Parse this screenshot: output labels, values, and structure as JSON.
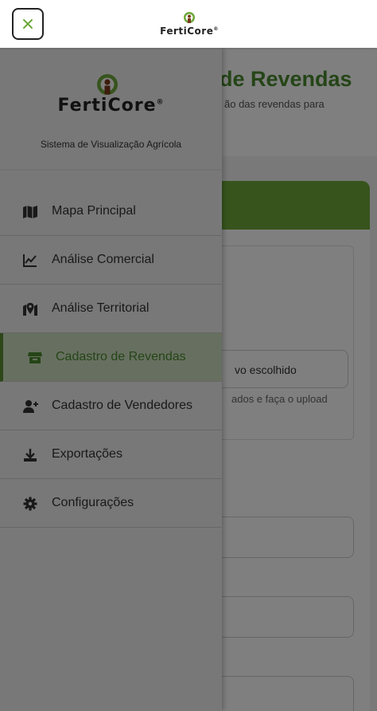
{
  "topbar": {
    "brand_name": "FertiCore",
    "brand_mark": "®"
  },
  "background_page": {
    "title": "de Revendas",
    "subtitle": "ão das revendas para",
    "file_status": "vo escolhido",
    "file_hint": "ados e faça o upload"
  },
  "drawer": {
    "brand_name": "FertiCore",
    "brand_mark": "®",
    "tagline": "Sistema de Visualização Agrícola",
    "items": [
      {
        "label": "Mapa Principal",
        "icon": "map-icon"
      },
      {
        "label": "Análise Comercial",
        "icon": "line-chart-icon"
      },
      {
        "label": "Análise Territorial",
        "icon": "map-marker-icon"
      },
      {
        "label": "Cadastro de Revendas",
        "icon": "store-icon",
        "active": true
      },
      {
        "label": "Cadastro de Vendedores",
        "icon": "add-user-icon"
      },
      {
        "label": "Exportações",
        "icon": "download-icon"
      },
      {
        "label": "Configurações",
        "icon": "gear-icon"
      }
    ]
  },
  "colors": {
    "accent_green": "#4a8a2f",
    "header_green": "#6ea93b",
    "active_bg": "#cfe0c0",
    "close_x": "#6ea93b"
  }
}
